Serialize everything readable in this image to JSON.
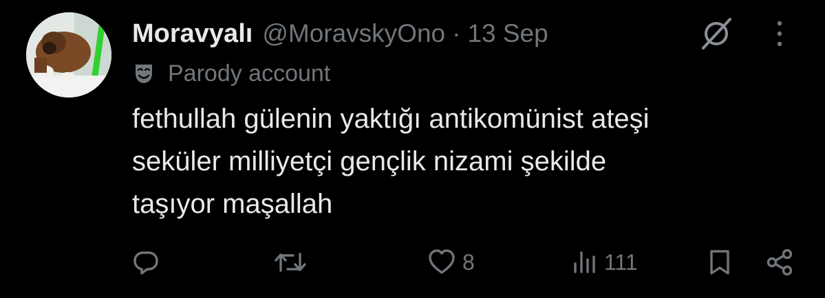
{
  "tweet": {
    "display_name": "Moravyalı",
    "handle": "@MoravskyOno",
    "separator": "·",
    "time": "13 Sep",
    "label_icon": "theater-mask-icon",
    "label": "Parody account",
    "text_lines": [
      "fethullah gülenin yaktığı antikomünist ateşi",
      "seküler milliyetçi gençlik nizami şekilde",
      "taşıyor maşallah"
    ]
  },
  "actions": {
    "reply": {
      "icon": "reply-icon",
      "count": ""
    },
    "repost": {
      "icon": "repost-icon",
      "count": ""
    },
    "like": {
      "icon": "heart-icon",
      "count": "8"
    },
    "views": {
      "icon": "views-chart-icon",
      "count": "111"
    },
    "bookmark": {
      "icon": "bookmark-icon"
    },
    "share": {
      "icon": "share-icon"
    }
  },
  "colors": {
    "background": "#000000",
    "primary_text": "#e7e9ea",
    "secondary_text": "#71767b",
    "avatar_accent": "#22c55e"
  }
}
